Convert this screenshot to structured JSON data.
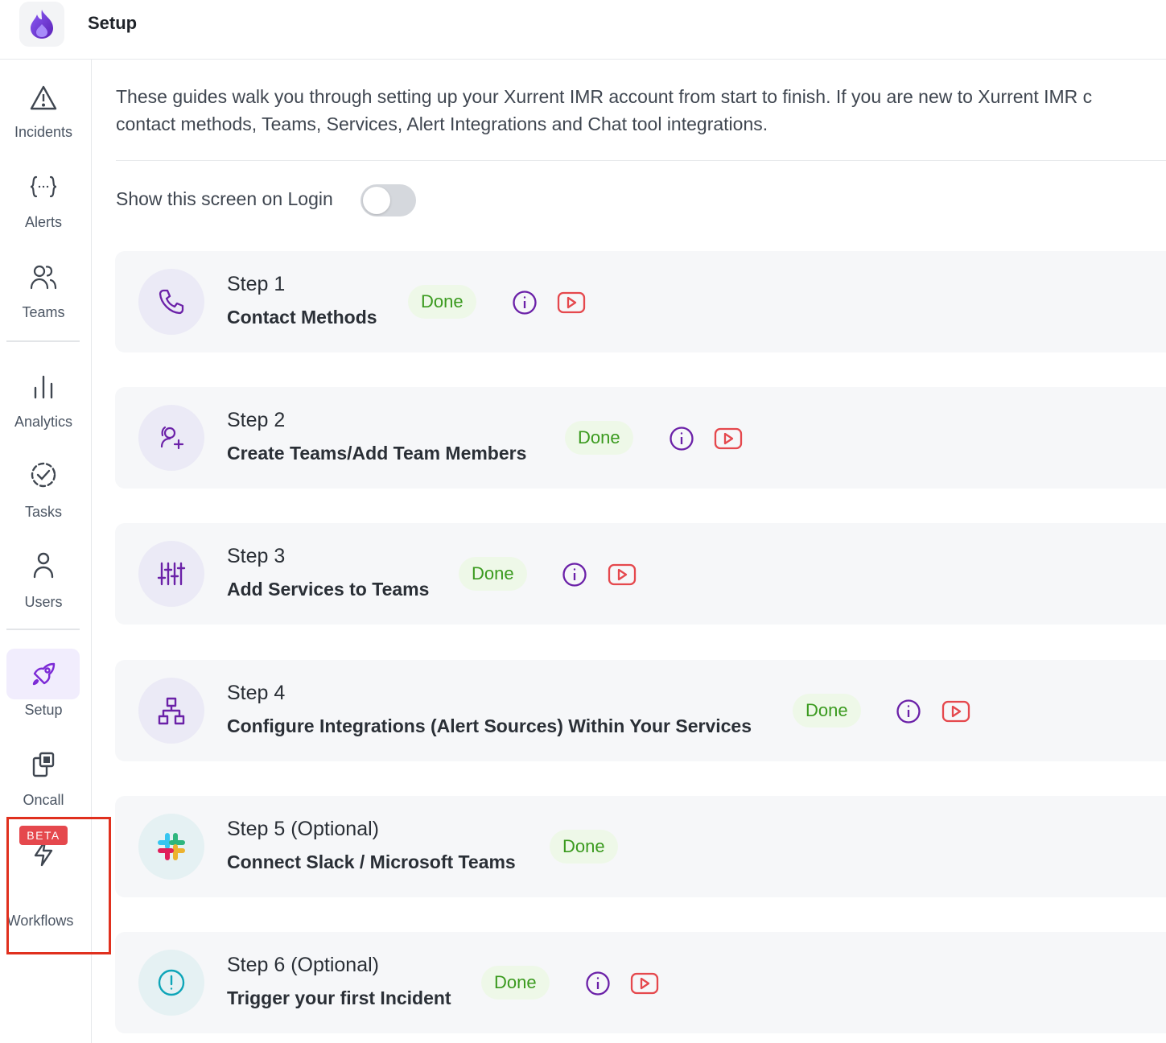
{
  "header": {
    "title": "Setup"
  },
  "sidebar": {
    "items": [
      {
        "label": "Incidents",
        "icon": "warning-triangle-icon"
      },
      {
        "label": "Alerts",
        "icon": "braces-icon"
      },
      {
        "label": "Teams",
        "icon": "people-icon"
      },
      {
        "label": "Analytics",
        "icon": "bar-chart-icon"
      },
      {
        "label": "Tasks",
        "icon": "check-circle-icon"
      },
      {
        "label": "Users",
        "icon": "user-icon"
      },
      {
        "label": "Setup",
        "icon": "rocket-icon",
        "active": true
      },
      {
        "label": "Oncall",
        "icon": "oncall-icon"
      },
      {
        "label": "Workflows",
        "icon": "lightning-icon",
        "badge": "BETA"
      }
    ]
  },
  "main": {
    "intro_line1": "These guides walk you through setting up your Xurrent IMR account from start to finish. If you are new to Xurrent IMR c",
    "intro_line2": "contact methods, Teams, Services, Alert Integrations and Chat tool integrations.",
    "toggle": {
      "label": "Show this screen on Login",
      "checked": false
    },
    "steps": [
      {
        "step": "Step 1",
        "title": "Contact Methods",
        "status": "Done",
        "icon": "phone-icon",
        "info": true,
        "video": true
      },
      {
        "step": "Step 2",
        "title": "Create Teams/Add Team Members",
        "status": "Done",
        "icon": "add-user-icon",
        "info": true,
        "video": true
      },
      {
        "step": "Step 3",
        "title": "Add Services to Teams",
        "status": "Done",
        "icon": "sliders-icon",
        "info": true,
        "video": true
      },
      {
        "step": "Step 4",
        "title": "Configure Integrations (Alert Sources) Within Your Services",
        "status": "Done",
        "icon": "hierarchy-icon",
        "info": true,
        "video": true
      },
      {
        "step": "Step 5 (Optional)",
        "title": "Connect Slack / Microsoft Teams",
        "status": "Done",
        "icon": "slack-icon",
        "info": false,
        "video": false
      },
      {
        "step": "Step 6 (Optional)",
        "title": "Trigger your first Incident",
        "status": "Done",
        "icon": "alert-circle-icon",
        "info": true,
        "video": true
      }
    ]
  },
  "colors": {
    "accent": "#6b21a8",
    "done_text": "#3a9a1e",
    "done_bg": "#eef8e8",
    "video": "#e5484d",
    "highlight": "#e0301e"
  }
}
